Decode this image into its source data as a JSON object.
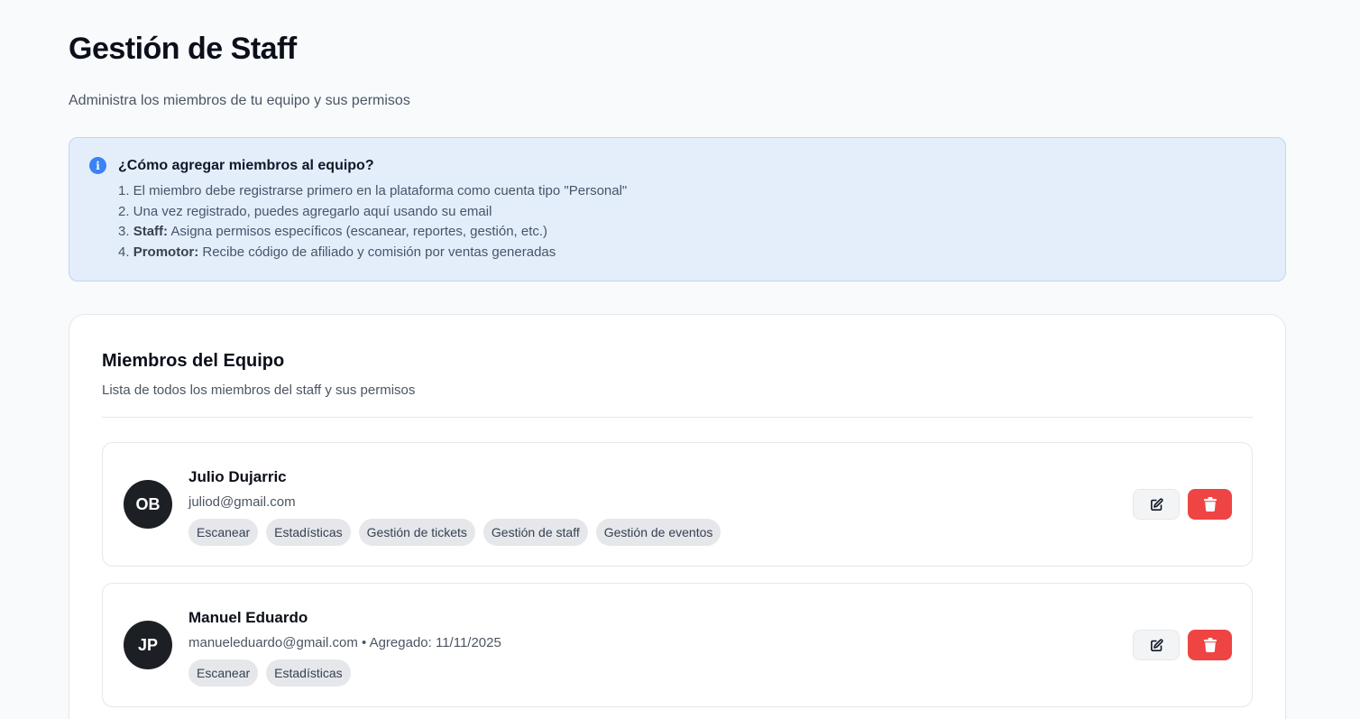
{
  "header": {
    "title": "Gestión de Staff",
    "subtitle": "Administra los miembros de tu equipo y sus permisos"
  },
  "info": {
    "icon": "info-icon",
    "title": "¿Cómo agregar miembros al equipo?",
    "step1": "1. El miembro debe registrarse primero en la plataforma como cuenta tipo \"Personal\"",
    "step2": "2. Una vez registrado, puedes agregarlo aquí usando su email",
    "step3_prefix": "3. ",
    "step3_bold": "Staff:",
    "step3_text": " Asigna permisos específicos (escanear, reportes, gestión, etc.)",
    "step4_prefix": "4. ",
    "step4_bold": "Promotor:",
    "step4_text": " Recibe código de afiliado y comisión por ventas generadas"
  },
  "team": {
    "title": "Miembros del Equipo",
    "subtitle": "Lista de todos los miembros del staff y sus permisos",
    "members": [
      {
        "initials": "OB",
        "name": "Julio Dujarric",
        "meta": "juliod@gmail.com",
        "tags": [
          "Escanear",
          "Estadísticas",
          "Gestión de tickets",
          "Gestión de staff",
          "Gestión de eventos"
        ]
      },
      {
        "initials": "JP",
        "name": "Manuel Eduardo",
        "meta": "manueleduardo@gmail.com • Agregado: 11/11/2025",
        "tags": [
          "Escanear",
          "Estadísticas"
        ]
      }
    ]
  },
  "icons": {
    "edit": "edit-icon",
    "delete": "trash-icon"
  },
  "colors": {
    "info_bg": "#e4eefb",
    "info_icon": "#3b82f6",
    "delete_button": "#ef4444",
    "avatar": "#1c1f24"
  }
}
